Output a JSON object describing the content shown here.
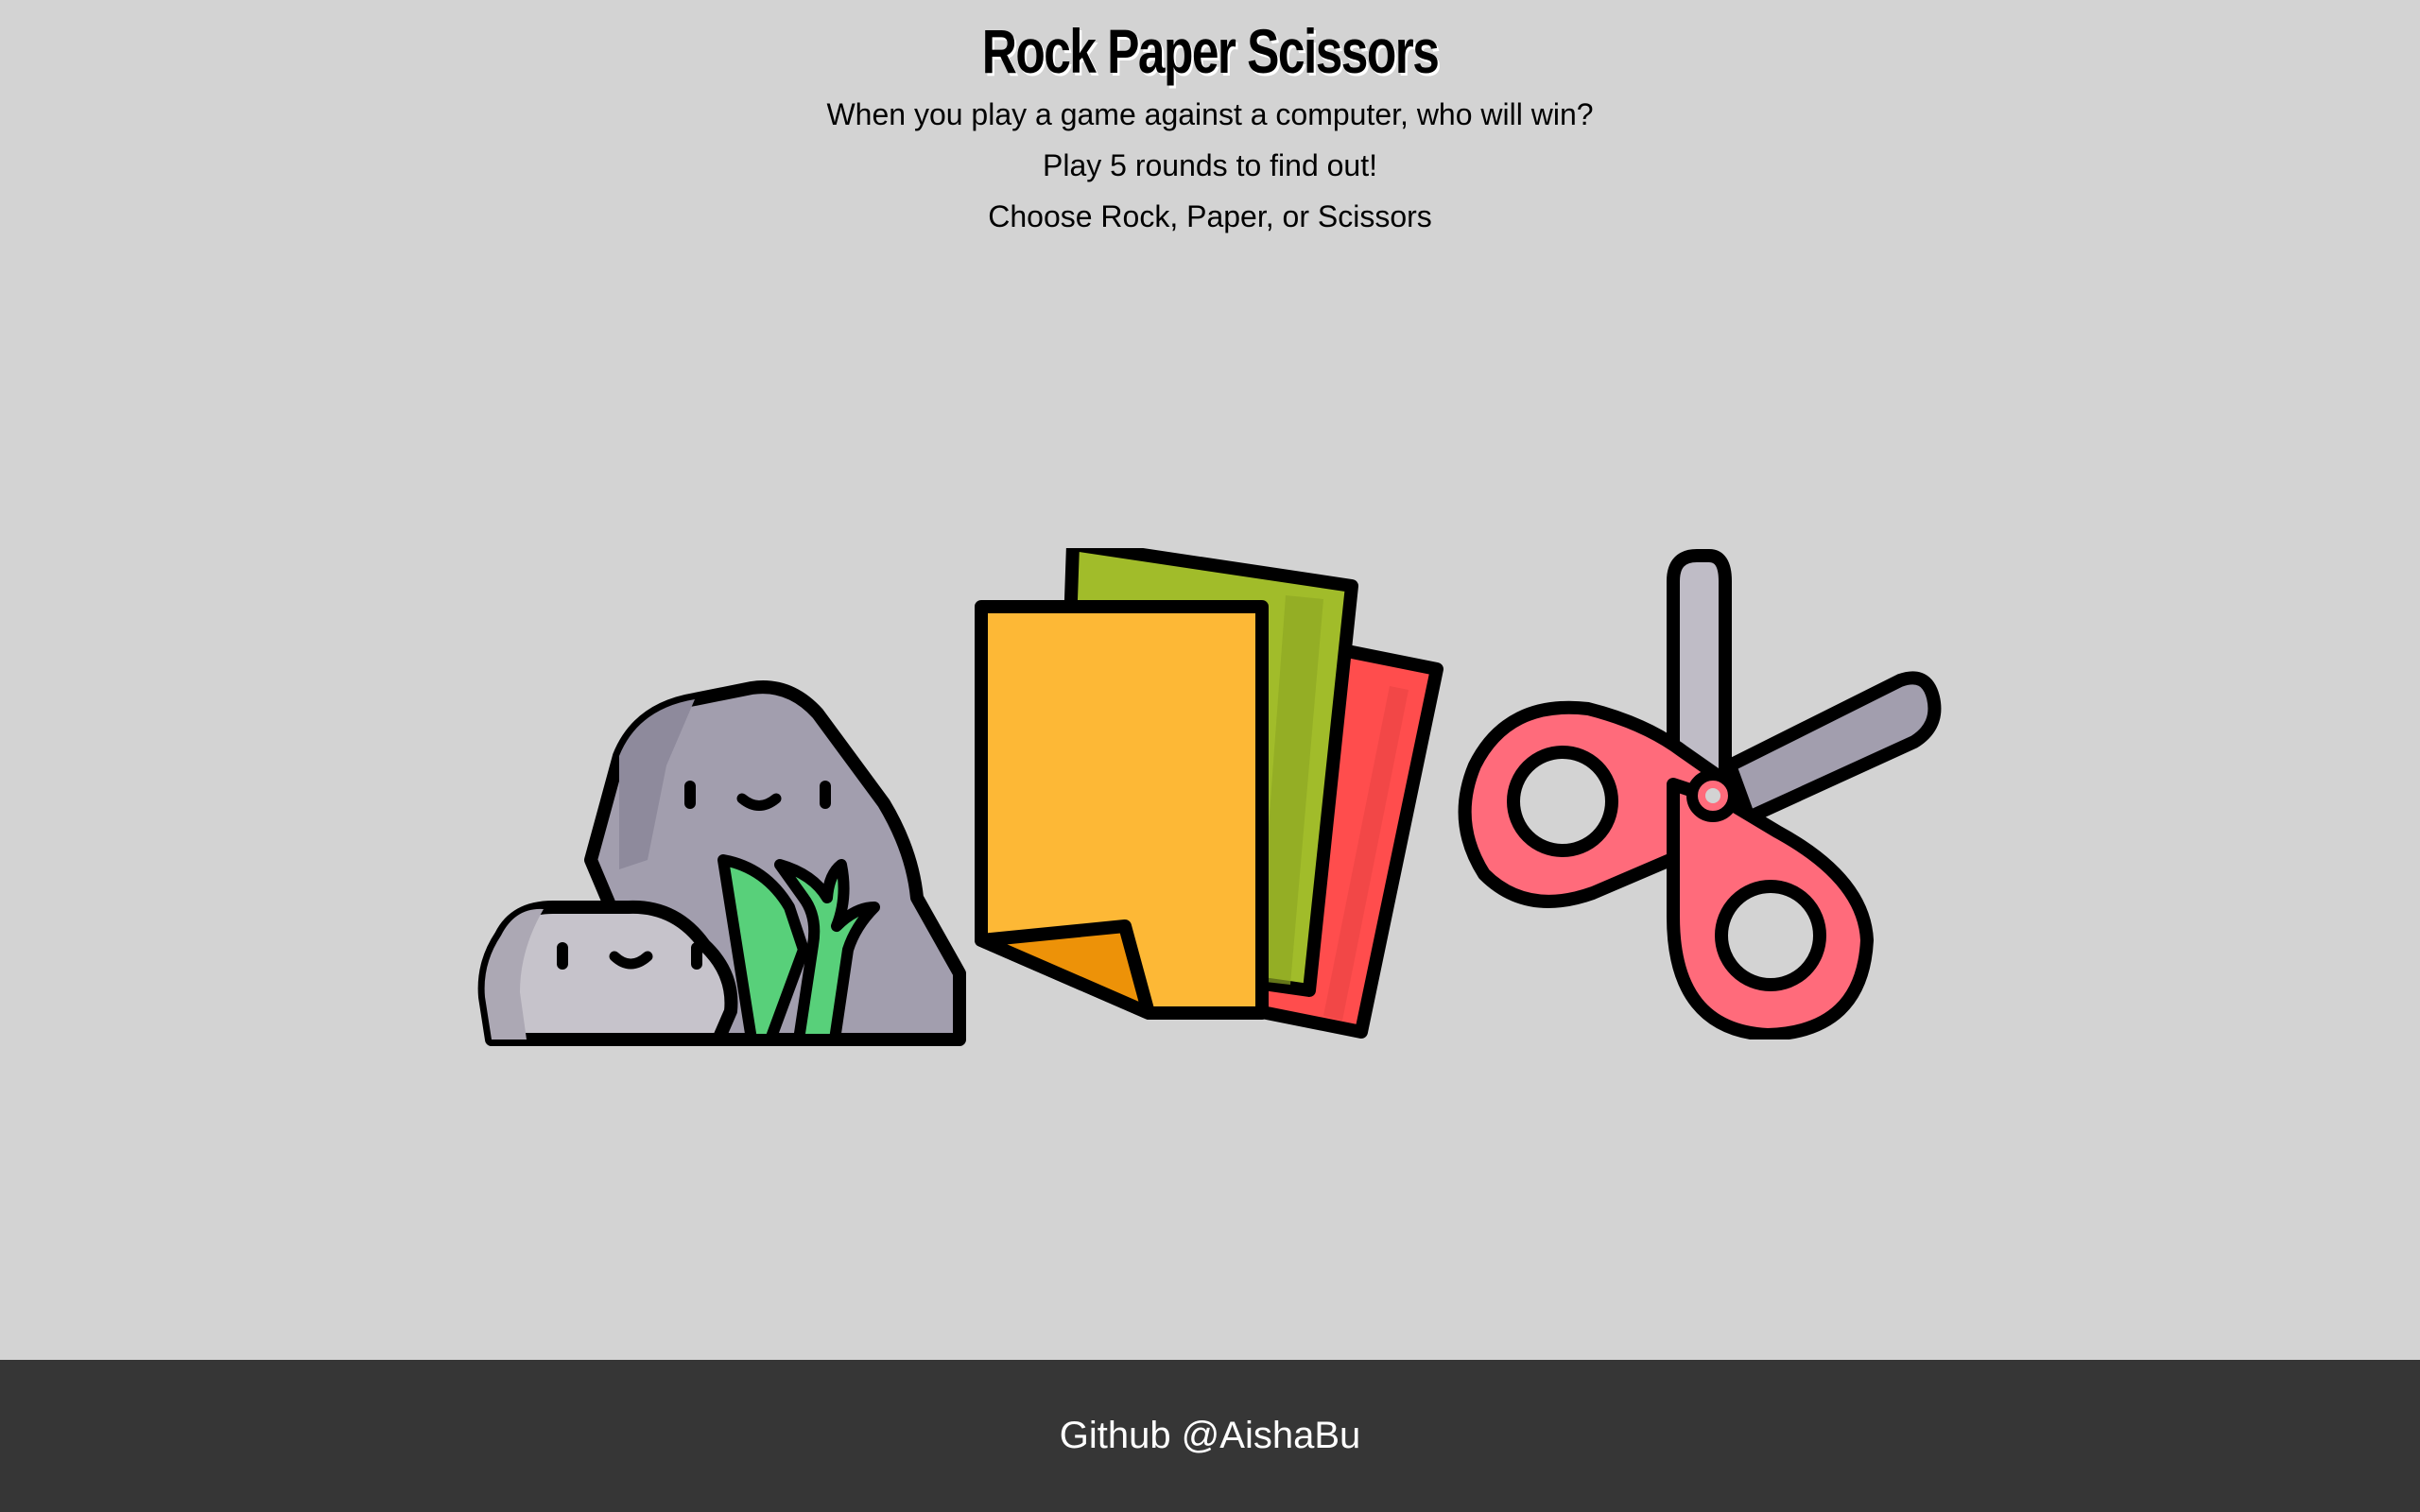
{
  "header": {
    "title": "Rock Paper Scissors",
    "lines": [
      "When you play a game against a computer, who will win?",
      "Play 5 rounds to find out!",
      "Choose Rock, Paper, or Scissors"
    ]
  },
  "choices": [
    {
      "id": "rock",
      "icon": "rock-icon"
    },
    {
      "id": "paper",
      "icon": "paper-icon"
    },
    {
      "id": "scissors",
      "icon": "scissors-icon"
    }
  ],
  "footer": {
    "link_text": "Github @AishaBu"
  },
  "colors": {
    "background": "#d3d3d3",
    "footer": "#363636",
    "rock_dark": "#a29eae",
    "rock_light": "#c6c3cb",
    "plant": "#58d07a",
    "paper_yellow": "#fdb836",
    "paper_green": "#a1bc2a",
    "paper_red": "#ff4d4d",
    "scissors_handle": "#ff6b7b",
    "scissors_blade": "#bfbcc6"
  }
}
